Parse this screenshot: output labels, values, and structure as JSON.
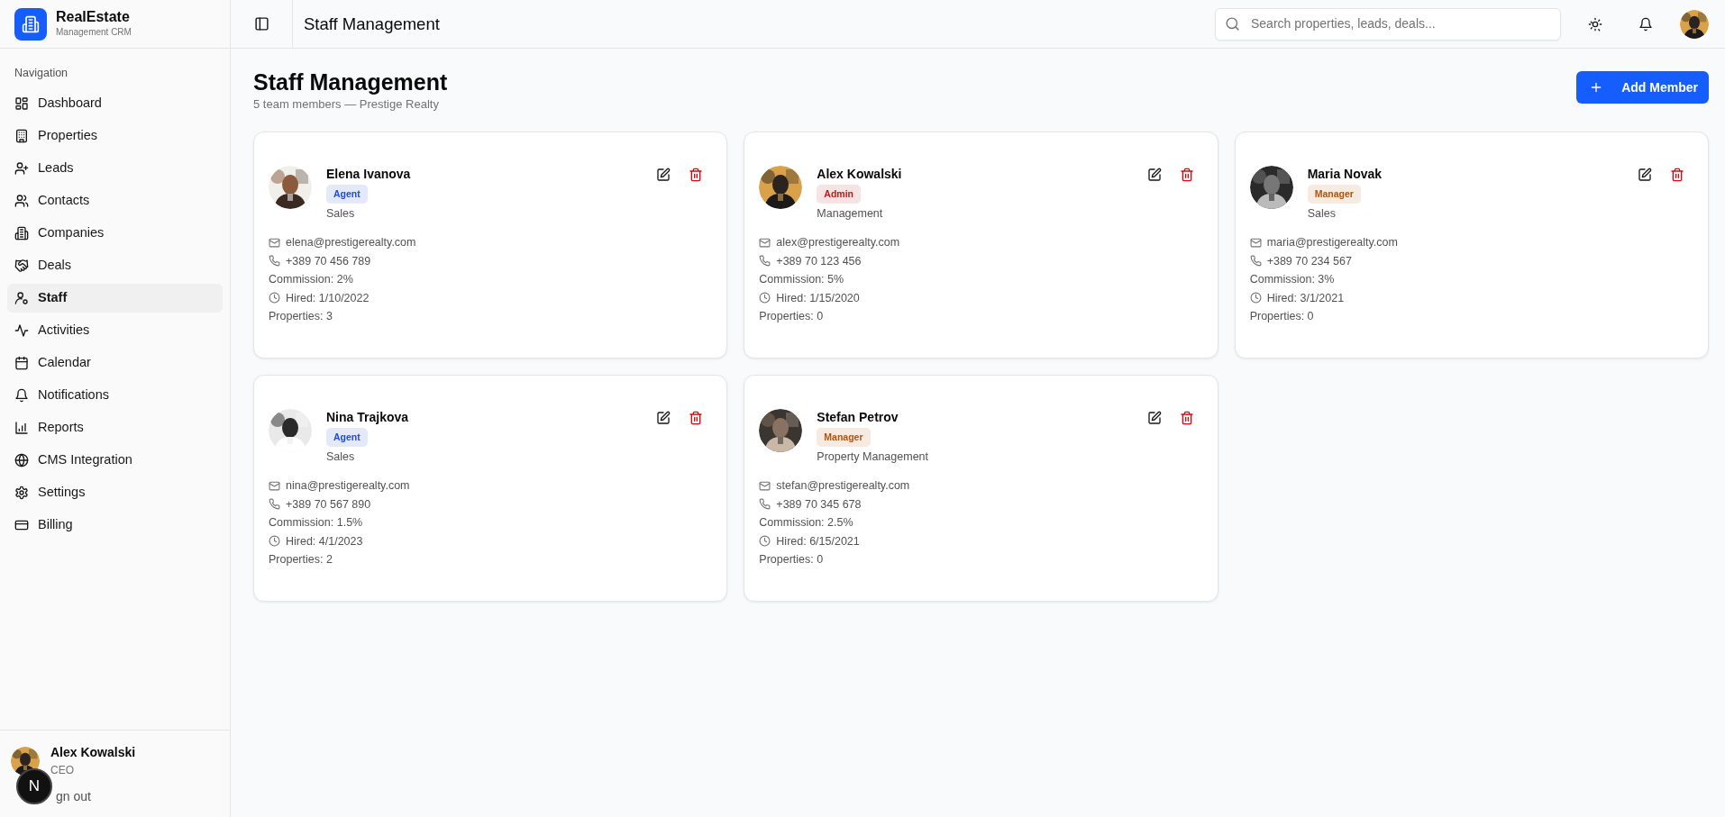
{
  "brand": {
    "name": "RealEstate",
    "tagline": "Management CRM"
  },
  "sidebar": {
    "section": "Navigation",
    "items": [
      {
        "label": "Dashboard",
        "selected": false
      },
      {
        "label": "Properties",
        "selected": false
      },
      {
        "label": "Leads",
        "selected": false
      },
      {
        "label": "Contacts",
        "selected": false
      },
      {
        "label": "Companies",
        "selected": false
      },
      {
        "label": "Deals",
        "selected": false
      },
      {
        "label": "Staff",
        "selected": true
      },
      {
        "label": "Activities",
        "selected": false
      },
      {
        "label": "Calendar",
        "selected": false
      },
      {
        "label": "Notifications",
        "selected": false
      },
      {
        "label": "Reports",
        "selected": false
      },
      {
        "label": "CMS Integration",
        "selected": false
      },
      {
        "label": "Settings",
        "selected": false
      },
      {
        "label": "Billing",
        "selected": false
      }
    ],
    "user": {
      "name": "Alex Kowalski",
      "role": "CEO"
    },
    "sign_out": "gn out",
    "dev_badge": "N"
  },
  "header": {
    "title": "Staff Management",
    "search": {
      "placeholder": "Search properties, leads, deals..."
    }
  },
  "page": {
    "title": "Staff Management",
    "subtitle": "5 team members — Prestige Realty",
    "add_button": "Add Member"
  },
  "staff": [
    {
      "name": "Elena Ivanova",
      "role": {
        "label": "Agent",
        "color": "#1d4ed8"
      },
      "department": "Sales",
      "details": [
        {
          "kind": "email",
          "text": "elena@prestigerealty.com"
        },
        {
          "kind": "phone",
          "text": "+389 70 456 789"
        },
        {
          "kind": "plain",
          "text": "Commission: 2%"
        },
        {
          "kind": "date",
          "text": "Hired: 1/10/2022"
        },
        {
          "kind": "plain",
          "text": "Properties: 3"
        }
      ]
    },
    {
      "name": "Alex Kowalski",
      "role": {
        "label": "Admin",
        "color": "#b91c1c"
      },
      "department": "Management",
      "details": [
        {
          "kind": "email",
          "text": "alex@prestigerealty.com"
        },
        {
          "kind": "phone",
          "text": "+389 70 123 456"
        },
        {
          "kind": "plain",
          "text": "Commission: 5%"
        },
        {
          "kind": "date",
          "text": "Hired: 1/15/2020"
        },
        {
          "kind": "plain",
          "text": "Properties: 0"
        }
      ]
    },
    {
      "name": "Maria Novak",
      "role": {
        "label": "Manager",
        "color": "#b45309"
      },
      "department": "Sales",
      "details": [
        {
          "kind": "email",
          "text": "maria@prestigerealty.com"
        },
        {
          "kind": "phone",
          "text": "+389 70 234 567"
        },
        {
          "kind": "plain",
          "text": "Commission: 3%"
        },
        {
          "kind": "date",
          "text": "Hired: 3/1/2021"
        },
        {
          "kind": "plain",
          "text": "Properties: 0"
        }
      ]
    },
    {
      "name": "Nina Trajkova",
      "role": {
        "label": "Agent",
        "color": "#1d4ed8"
      },
      "department": "Sales",
      "details": [
        {
          "kind": "email",
          "text": "nina@prestigerealty.com"
        },
        {
          "kind": "phone",
          "text": "+389 70 567 890"
        },
        {
          "kind": "plain",
          "text": "Commission: 1.5%"
        },
        {
          "kind": "date",
          "text": "Hired: 4/1/2023"
        },
        {
          "kind": "plain",
          "text": "Properties: 2"
        }
      ]
    },
    {
      "name": "Stefan Petrov",
      "role": {
        "label": "Manager",
        "color": "#b45309"
      },
      "department": "Property Management",
      "details": [
        {
          "kind": "email",
          "text": "stefan@prestigerealty.com"
        },
        {
          "kind": "phone",
          "text": "+389 70 345 678"
        },
        {
          "kind": "plain",
          "text": "Commission: 2.5%"
        },
        {
          "kind": "date",
          "text": "Hired: 6/15/2021"
        },
        {
          "kind": "plain",
          "text": "Properties: 0"
        }
      ]
    }
  ]
}
